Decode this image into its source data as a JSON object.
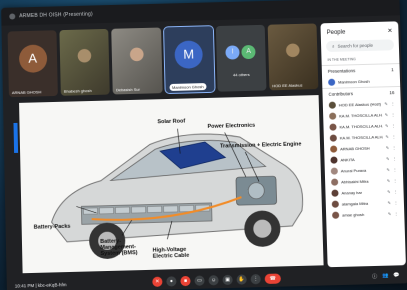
{
  "window": {
    "title": "ARMEB DH OISH (Presenting)"
  },
  "tiles": [
    {
      "name": "ARNAB GHOSH",
      "initial": "A",
      "color": "#8e5b3a"
    },
    {
      "name": "Bhabesh ghosh",
      "initial": "",
      "color": "#54503a"
    },
    {
      "name": "Debasish Sur",
      "initial": "",
      "color": "#6b6a63"
    },
    {
      "name": "Manimoon Ghosh",
      "initial": "M",
      "color": "#3b66c4"
    },
    {
      "name": "44 others",
      "initial": "",
      "color": "#3c4043"
    },
    {
      "name": "HOD EE Alaskus",
      "initial": "",
      "color": "#5a4e3a"
    }
  ],
  "others_avatars": [
    {
      "initial": "I",
      "color": "#7baaf7"
    },
    {
      "initial": "A",
      "color": "#5bb974"
    }
  ],
  "slide": {
    "labels": {
      "solar_roof": "Solar Roof",
      "power_electronics": "Power Electronics",
      "transmission": "Transmission + Electric Engine",
      "battery_packs": "Battery-Packs",
      "bms": "Battery-\nManagement-\nSystem (BMS)",
      "hv_cable": "High-Voltage\nElectric Cable"
    }
  },
  "sidebar": {
    "title": "People",
    "search_placeholder": "Search for people",
    "section_label": "IN THE MEETING",
    "groups": [
      {
        "label": "Presentations",
        "count": "1"
      },
      {
        "label": "Contributors",
        "count": "16"
      }
    ],
    "presenter": {
      "name": "Manimoon Ghosh",
      "color": "#3b66c4"
    },
    "people": [
      {
        "name": "HOD EE Alaskus (Host)",
        "color": "#5a4e3a"
      },
      {
        "name": "KA.M. THOSCILLA ALHA",
        "color": "#8b6f5a"
      },
      {
        "name": "KA.M. THOSCILLA ALHA",
        "color": "#795548"
      },
      {
        "name": "KA.M. THOSCILLA ALHA",
        "color": "#6d4c41"
      },
      {
        "name": "ARNAB GHOSH",
        "color": "#8e5b3a"
      },
      {
        "name": "ANKITA",
        "color": "#4e342e"
      },
      {
        "name": "Anurai Purava",
        "color": "#a1887f"
      },
      {
        "name": "Abhisakhi Mitra",
        "color": "#8d6e63"
      },
      {
        "name": "Ananay har",
        "color": "#5d4037"
      },
      {
        "name": "alamgala Mitra",
        "color": "#6d4c41"
      },
      {
        "name": "amae ghosh",
        "color": "#795548"
      }
    ]
  },
  "bottombar": {
    "time": "10:41 PM | kbc-eKqB-hfm"
  }
}
